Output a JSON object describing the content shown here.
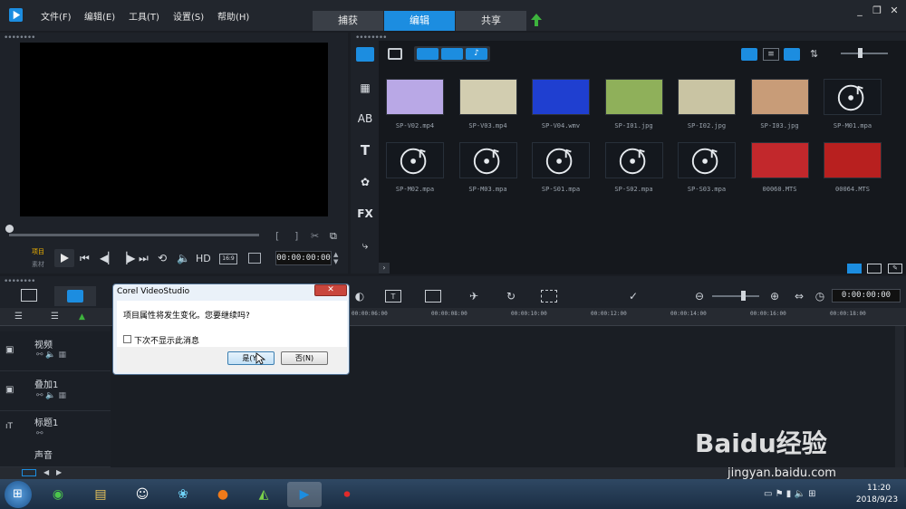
{
  "app": {
    "menu": [
      "文件(F)",
      "编辑(E)",
      "工具(T)",
      "设置(S)",
      "帮助(H)"
    ],
    "tabs": [
      "捕获",
      "编辑",
      "共享"
    ],
    "active_tab": "编辑"
  },
  "player": {
    "mode_project": "项目",
    "mode_clip": "素材",
    "hd_label": "HD",
    "aspect": "16:9",
    "timecode": "00:00:00:00"
  },
  "library": {
    "items": [
      {
        "name": "SP-V02.mp4",
        "color": "#b9a8e6"
      },
      {
        "name": "SP-V03.mp4",
        "color": "#d2cdb0"
      },
      {
        "name": "SP-V04.wmv",
        "color": "#1f3fd0"
      },
      {
        "name": "SP-I01.jpg",
        "color": "#8fb05a"
      },
      {
        "name": "SP-I02.jpg",
        "color": "#c9c4a3"
      },
      {
        "name": "SP-I03.jpg",
        "color": "#c89c78"
      },
      {
        "name": "SP-M01.mpa",
        "color": "music"
      },
      {
        "name": "SP-M02.mpa",
        "color": "music"
      },
      {
        "name": "SP-M03.mpa",
        "color": "music"
      },
      {
        "name": "SP-S01.mpa",
        "color": "music"
      },
      {
        "name": "SP-S02.mpa",
        "color": "music"
      },
      {
        "name": "SP-S03.mpa",
        "color": "music"
      },
      {
        "name": "00060.MTS",
        "color": "#c2282c"
      },
      {
        "name": "00064.MTS",
        "color": "#b8201f"
      }
    ],
    "side_labels": {
      "fx": "FX",
      "title": "T"
    }
  },
  "timeline": {
    "timecode": "0:00:00:00",
    "ruler": [
      "00:00:06:00",
      "00:00:08:00",
      "00:00:10:00",
      "00:00:12:00",
      "00:00:14:00",
      "00:00:16:00",
      "00:00:18:00"
    ],
    "tracks": [
      "视频",
      "叠加1",
      "标题1",
      "声音"
    ]
  },
  "dialog": {
    "title": "Corel VideoStudio",
    "message": "项目属性将发生变化。您要继续吗?",
    "checkbox_label": "下次不显示此消息",
    "yes": "是(Y)",
    "no": "否(N)"
  },
  "taskbar": {
    "time": "11:20",
    "date": "2018/9/23"
  },
  "watermark": {
    "brand": "Baidu经验",
    "url": "jingyan.baidu.com"
  }
}
